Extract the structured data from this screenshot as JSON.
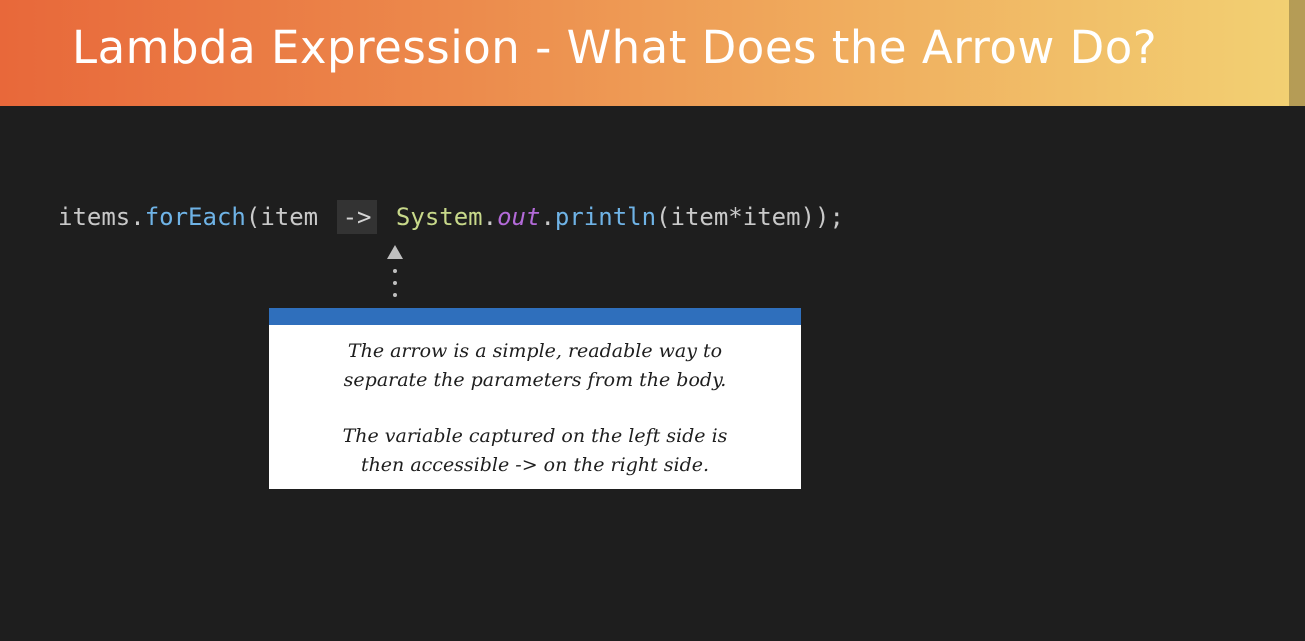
{
  "slide": {
    "title": "Lambda Expression - What Does the Arrow Do?"
  },
  "code": {
    "receiver": "items",
    "dot1": ".",
    "method": "forEach",
    "open_paren": "(",
    "param": "item",
    "arrow": "->",
    "class_name": "System",
    "dot2": ".",
    "field": "out",
    "dot3": ".",
    "call": "println",
    "args": "(item*item));"
  },
  "callout": {
    "line1": "The arrow is a simple, readable way to",
    "line2": "separate the parameters from the body.",
    "line3": "The variable captured on the left side is",
    "line4": "then accessible -> on the right side."
  },
  "colors": {
    "header_gradient_start": "#e8683a",
    "header_gradient_end": "#f2d173",
    "background": "#1e1e1e",
    "callout_bar": "#2f6fbc",
    "method_color": "#6fb3e6",
    "class_color": "#c8d98a",
    "field_color": "#b36ad8"
  }
}
